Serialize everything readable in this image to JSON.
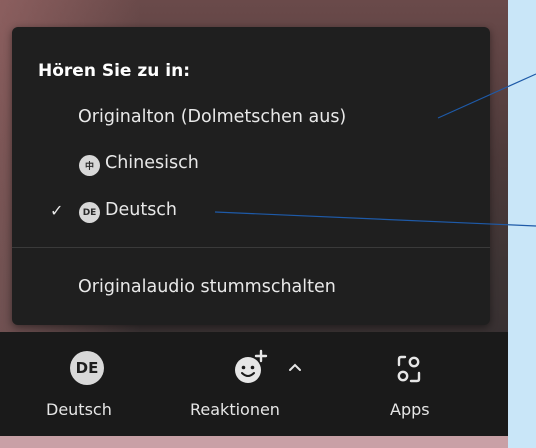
{
  "popup": {
    "title": "Hören Sie zu in:",
    "items": [
      {
        "label": "Originalton (Dolmetschen aus)",
        "badge": "",
        "checked": false
      },
      {
        "label": "Chinesisch",
        "badge": "中",
        "checked": false
      },
      {
        "label": "Deutsch",
        "badge": "DE",
        "checked": true
      }
    ],
    "mute_label": "Originalaudio stummschalten",
    "check_mark": "✓"
  },
  "toolbar": {
    "language": {
      "avatar": "DE",
      "label": "Deutsch"
    },
    "reactions": {
      "label": "Reaktionen",
      "icon": "smiley-add-icon"
    },
    "apps": {
      "label": "Apps",
      "icon": "apps-icon"
    }
  },
  "colors": {
    "popup_bg": "#1f1f1f",
    "toolbar_bg": "#1a1a1a",
    "callout_line": "#1e5aa8",
    "page_bg": "#c9e6f8"
  }
}
